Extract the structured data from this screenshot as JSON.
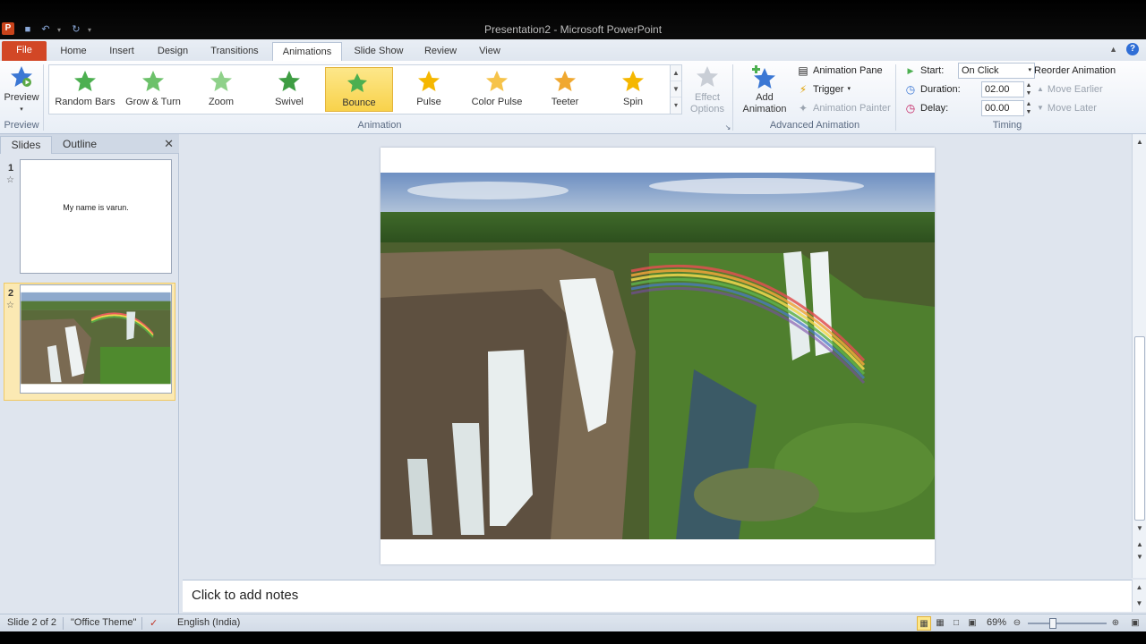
{
  "window": {
    "title": "Presentation2 - Microsoft PowerPoint",
    "app_icon": "P"
  },
  "tabs": [
    {
      "label": "File"
    },
    {
      "label": "Home"
    },
    {
      "label": "Insert"
    },
    {
      "label": "Design"
    },
    {
      "label": "Transitions"
    },
    {
      "label": "Animations"
    },
    {
      "label": "Slide Show"
    },
    {
      "label": "Review"
    },
    {
      "label": "View"
    }
  ],
  "ribbon": {
    "preview": {
      "label": "Preview",
      "group": "Preview"
    },
    "gallery": {
      "group": "Animation",
      "items": [
        {
          "label": "Random Bars",
          "color": "#4caf50"
        },
        {
          "label": "Grow & Turn",
          "color": "#4caf50"
        },
        {
          "label": "Zoom",
          "color": "#4caf50"
        },
        {
          "label": "Swivel",
          "color": "#4caf50"
        },
        {
          "label": "Bounce",
          "color": "#4caf50",
          "selected": true
        },
        {
          "label": "Pulse",
          "color": "#f5b700"
        },
        {
          "label": "Color Pulse",
          "color": "#f5b700"
        },
        {
          "label": "Teeter",
          "color": "#f5b700"
        },
        {
          "label": "Spin",
          "color": "#f5b700"
        }
      ]
    },
    "effect_options": {
      "line1": "Effect",
      "line2": "Options"
    },
    "advanced": {
      "group": "Advanced Animation",
      "add_line1": "Add",
      "add_line2": "Animation",
      "pane": "Animation Pane",
      "trigger": "Trigger",
      "painter": "Animation Painter"
    },
    "timing": {
      "group": "Timing",
      "start_label": "Start:",
      "start_value": "On Click",
      "duration_label": "Duration:",
      "duration_value": "02.00",
      "delay_label": "Delay:",
      "delay_value": "00.00",
      "reorder": "Reorder Animation",
      "move_earlier": "Move Earlier",
      "move_later": "Move Later"
    }
  },
  "panel": {
    "tabs": [
      "Slides",
      "Outline"
    ],
    "slides": [
      {
        "number": "1",
        "text": "My name is varun."
      },
      {
        "number": "2",
        "text": ""
      }
    ]
  },
  "notes": {
    "placeholder": "Click to add notes"
  },
  "status": {
    "slide": "Slide 2 of 2",
    "theme": "\"Office Theme\"",
    "language": "English (India)",
    "zoom": "69%"
  }
}
